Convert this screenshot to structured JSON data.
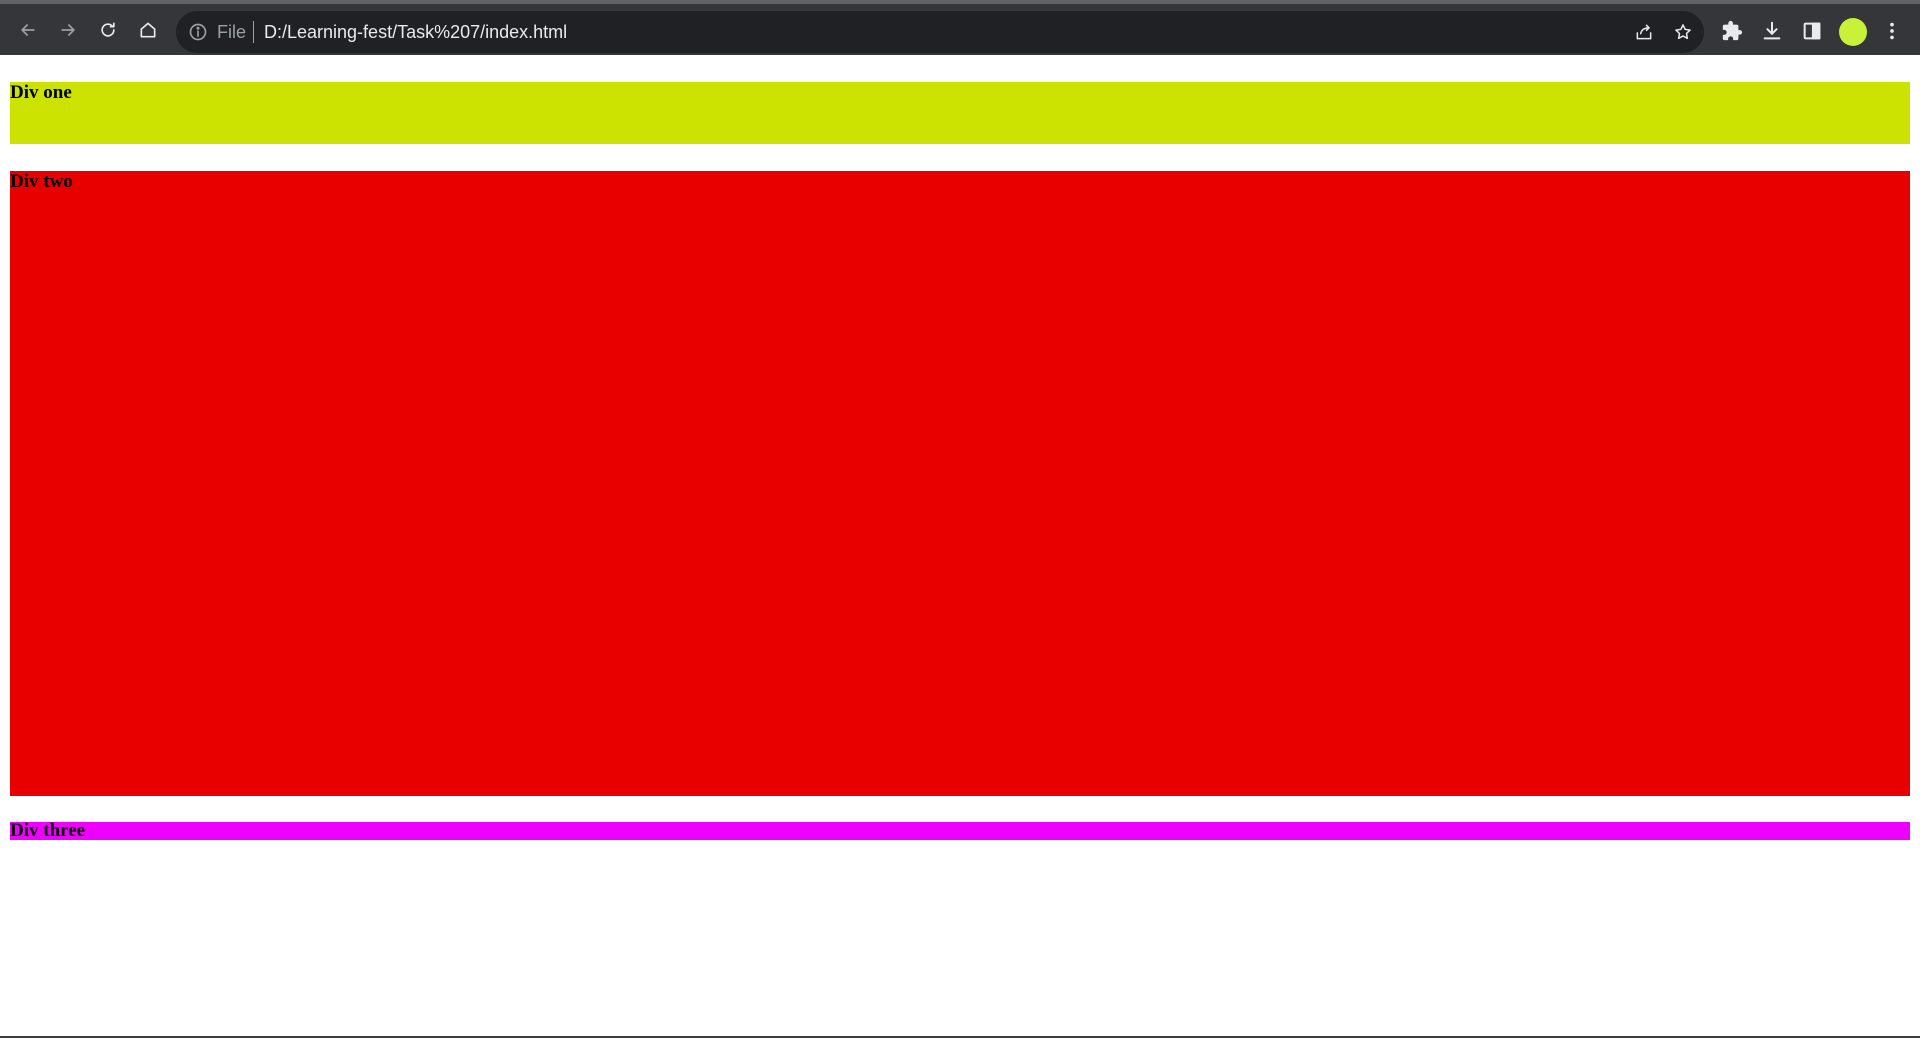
{
  "browser": {
    "address_scheme_label": "File",
    "url": "D:/Learning-fest/Task%207/index.html",
    "icons": {
      "back": "arrow-left-icon",
      "forward": "arrow-right-icon",
      "reload": "reload-icon",
      "home": "home-icon",
      "info": "info-icon",
      "share": "share-icon",
      "bookmark": "star-icon",
      "extensions": "puzzle-icon",
      "downloads": "download-icon",
      "side_panel": "side-panel-icon",
      "menu": "kebab-menu-icon"
    },
    "colors": {
      "toolbar": "#35363a",
      "omnibox": "#202124",
      "avatar": "#c8f23a"
    }
  },
  "page": {
    "divs": [
      {
        "label": "Div one",
        "color": "#cce200"
      },
      {
        "label": "Div two",
        "color": "#e80000"
      },
      {
        "label": "Div three",
        "color": "#ee00ff"
      }
    ]
  }
}
